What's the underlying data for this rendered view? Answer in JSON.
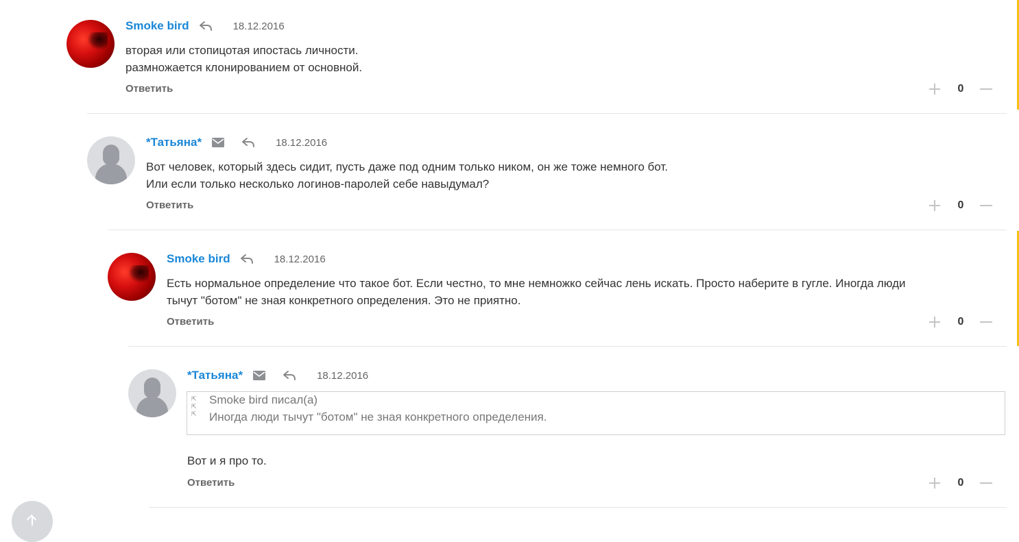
{
  "comments": [
    {
      "author": "Smoke bird",
      "date": "18.12.2016",
      "avatar": "red-abstract-avatar",
      "has_mail": false,
      "lines": [
        "вторая или стопицотая ипостась личности.",
        "размножается клонированием от основной."
      ],
      "reply_label": "Ответить",
      "score": "0"
    },
    {
      "author": "*Татьяна*",
      "date": "18.12.2016",
      "avatar": "default-female-avatar",
      "has_mail": true,
      "lines": [
        "Вот человек, который здесь сидит, пусть даже под одним только ником, он же тоже немного бот.",
        "Или если только несколько логинов-паролей себе навыдумал?"
      ],
      "reply_label": "Ответить",
      "score": "0"
    },
    {
      "author": "Smoke bird",
      "date": "18.12.2016",
      "avatar": "red-abstract-avatar",
      "has_mail": false,
      "lines": [
        "Есть нормальное определение что такое бот. Если честно, то мне немножко сейчас лень искать. Просто наберите в гугле. Иногда люди",
        "тычут \"ботом\" не зная конкретного определения. Это не приятно."
      ],
      "reply_label": "Ответить",
      "score": "0"
    },
    {
      "author": "*Татьяна*",
      "date": "18.12.2016",
      "avatar": "default-female-avatar",
      "has_mail": true,
      "quote": {
        "author_line": "Smoke bird писал(а)",
        "text": "Иногда люди тычут \"ботом\" не зная конкретного определения."
      },
      "lines": [
        "Вот и я про то."
      ],
      "reply_label": "Ответить",
      "score": "0"
    }
  ],
  "colors": {
    "author": "#1a87d8",
    "accent": "#f5c215",
    "divider": "#e6e6e6",
    "text": "#333333"
  },
  "icons": {
    "reply": "reply-arrow-icon",
    "mail": "envelope-icon",
    "plus": "plus-icon",
    "minus": "minus-icon",
    "scroll_top": "arrow-up-icon"
  }
}
